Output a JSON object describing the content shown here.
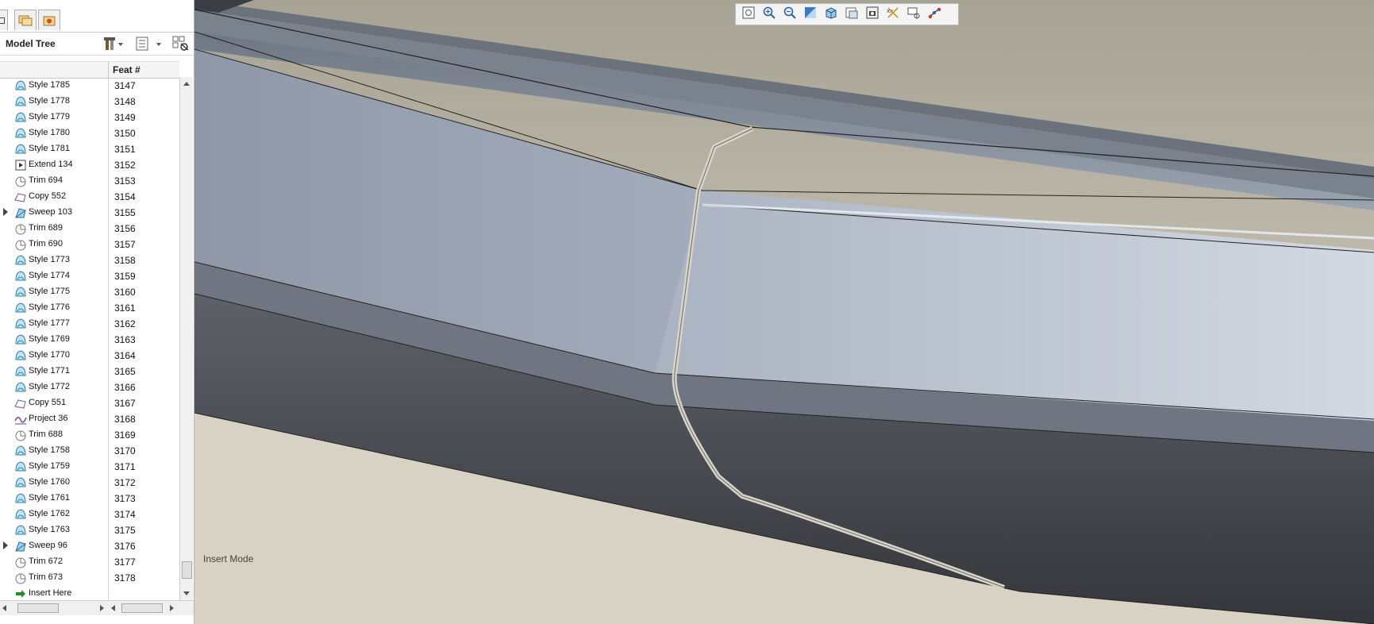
{
  "model_tree": {
    "title": "Model Tree",
    "column_feat": "Feat #",
    "rows": [
      {
        "name": "Style 1785",
        "feat": "3147",
        "icon": "style-icon"
      },
      {
        "name": "Style 1778",
        "feat": "3148",
        "icon": "style-icon"
      },
      {
        "name": "Style 1779",
        "feat": "3149",
        "icon": "style-icon"
      },
      {
        "name": "Style 1780",
        "feat": "3150",
        "icon": "style-icon"
      },
      {
        "name": "Style 1781",
        "feat": "3151",
        "icon": "style-icon"
      },
      {
        "name": "Extend 134",
        "feat": "3152",
        "icon": "extend-icon"
      },
      {
        "name": "Trim 694",
        "feat": "3153",
        "icon": "trim-icon"
      },
      {
        "name": "Copy 552",
        "feat": "3154",
        "icon": "copy-icon"
      },
      {
        "name": "Sweep 103",
        "feat": "3155",
        "icon": "sweep-icon",
        "expandable": true
      },
      {
        "name": "Trim 689",
        "feat": "3156",
        "icon": "trim-icon"
      },
      {
        "name": "Trim 690",
        "feat": "3157",
        "icon": "trim-icon"
      },
      {
        "name": "Style 1773",
        "feat": "3158",
        "icon": "style-icon"
      },
      {
        "name": "Style 1774",
        "feat": "3159",
        "icon": "style-icon"
      },
      {
        "name": "Style 1775",
        "feat": "3160",
        "icon": "style-icon"
      },
      {
        "name": "Style 1776",
        "feat": "3161",
        "icon": "style-icon"
      },
      {
        "name": "Style 1777",
        "feat": "3162",
        "icon": "style-icon"
      },
      {
        "name": "Style 1769",
        "feat": "3163",
        "icon": "style-icon"
      },
      {
        "name": "Style 1770",
        "feat": "3164",
        "icon": "style-icon"
      },
      {
        "name": "Style 1771",
        "feat": "3165",
        "icon": "style-icon"
      },
      {
        "name": "Style 1772",
        "feat": "3166",
        "icon": "style-icon"
      },
      {
        "name": "Copy 551",
        "feat": "3167",
        "icon": "copy-icon"
      },
      {
        "name": "Project 36",
        "feat": "3168",
        "icon": "project-icon"
      },
      {
        "name": "Trim 688",
        "feat": "3169",
        "icon": "trim-icon"
      },
      {
        "name": "Style 1758",
        "feat": "3170",
        "icon": "style-icon"
      },
      {
        "name": "Style 1759",
        "feat": "3171",
        "icon": "style-icon"
      },
      {
        "name": "Style 1760",
        "feat": "3172",
        "icon": "style-icon"
      },
      {
        "name": "Style 1761",
        "feat": "3173",
        "icon": "style-icon"
      },
      {
        "name": "Style 1762",
        "feat": "3174",
        "icon": "style-icon"
      },
      {
        "name": "Style 1763",
        "feat": "3175",
        "icon": "style-icon"
      },
      {
        "name": "Sweep 96",
        "feat": "3176",
        "icon": "sweep-icon",
        "expandable": true
      },
      {
        "name": "Trim 672",
        "feat": "3177",
        "icon": "trim-icon"
      },
      {
        "name": "Trim 673",
        "feat": "3178",
        "icon": "trim-icon"
      },
      {
        "name": "Insert Here",
        "feat": "",
        "icon": "insert-arrow-icon"
      }
    ]
  },
  "viewport": {
    "status_text": "Insert Mode",
    "toolbar_icons": [
      "refit-icon",
      "zoom-in-icon",
      "zoom-out-icon",
      "repaint-icon",
      "display-style-icon",
      "saved-views-icon",
      "layers-icon",
      "annotation-display-icon",
      "datum-display-icon",
      "spin-center-icon"
    ]
  },
  "colors": {
    "background": "#cfccbe",
    "surface_light": "#b5bfcb",
    "surface_dark": "#3f4247",
    "accent_selection": "#d8d4c8"
  }
}
